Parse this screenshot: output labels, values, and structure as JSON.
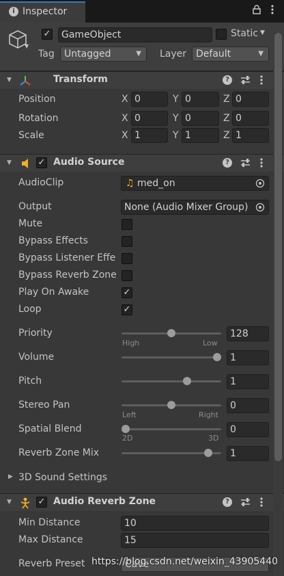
{
  "tab": {
    "title": "Inspector"
  },
  "header": {
    "name": "GameObject",
    "static_label": "Static",
    "tag_label": "Tag",
    "tag_value": "Untagged",
    "layer_label": "Layer",
    "layer_value": "Default"
  },
  "transform": {
    "title": "Transform",
    "rows": [
      {
        "label": "Position",
        "x": "0",
        "y": "0",
        "z": "0"
      },
      {
        "label": "Rotation",
        "x": "0",
        "y": "0",
        "z": "0"
      },
      {
        "label": "Scale",
        "x": "1",
        "y": "1",
        "z": "1"
      }
    ],
    "axes": {
      "x": "X",
      "y": "Y",
      "z": "Z"
    }
  },
  "audio_source": {
    "title": "Audio Source",
    "audioclip_label": "AudioClip",
    "audioclip_value": "med_on",
    "output_label": "Output",
    "output_value": "None (Audio Mixer Group)",
    "toggles": [
      {
        "label": "Mute",
        "checked": false
      },
      {
        "label": "Bypass Effects",
        "checked": false
      },
      {
        "label": "Bypass Listener Effe",
        "checked": false
      },
      {
        "label": "Bypass Reverb Zone",
        "checked": false
      },
      {
        "label": "Play On Awake",
        "checked": true
      },
      {
        "label": "Loop",
        "checked": true
      }
    ],
    "priority": {
      "label": "Priority",
      "value": "128",
      "level": 0.5,
      "low_label": "High",
      "high_label": "Low"
    },
    "volume": {
      "label": "Volume",
      "value": "1",
      "level": 1.0
    },
    "pitch": {
      "label": "Pitch",
      "value": "1",
      "level": 0.67
    },
    "stereo_pan": {
      "label": "Stereo Pan",
      "value": "0",
      "level": 0.5,
      "low_label": "Left",
      "high_label": "Right"
    },
    "spatial_blend": {
      "label": "Spatial Blend",
      "value": "0",
      "level": 0.0,
      "low_label": "2D",
      "high_label": "3D"
    },
    "reverb_zone_mix": {
      "label": "Reverb Zone Mix",
      "value": "1",
      "level": 0.9
    },
    "sound_settings_label": "3D Sound Settings"
  },
  "audio_reverb_zone": {
    "title": "Audio Reverb Zone",
    "min_distance_label": "Min Distance",
    "min_distance_value": "10",
    "max_distance_label": "Max Distance",
    "max_distance_value": "15",
    "reverb_preset_label": "Reverb Preset",
    "reverb_preset_value": "Cave"
  },
  "watermark": "https://blog.csdn.net/weixin_43905440",
  "colors": {
    "accent": "#3a79bb",
    "background": "#383838",
    "header": "#3e3e3e",
    "field": "#2a2a2a"
  }
}
